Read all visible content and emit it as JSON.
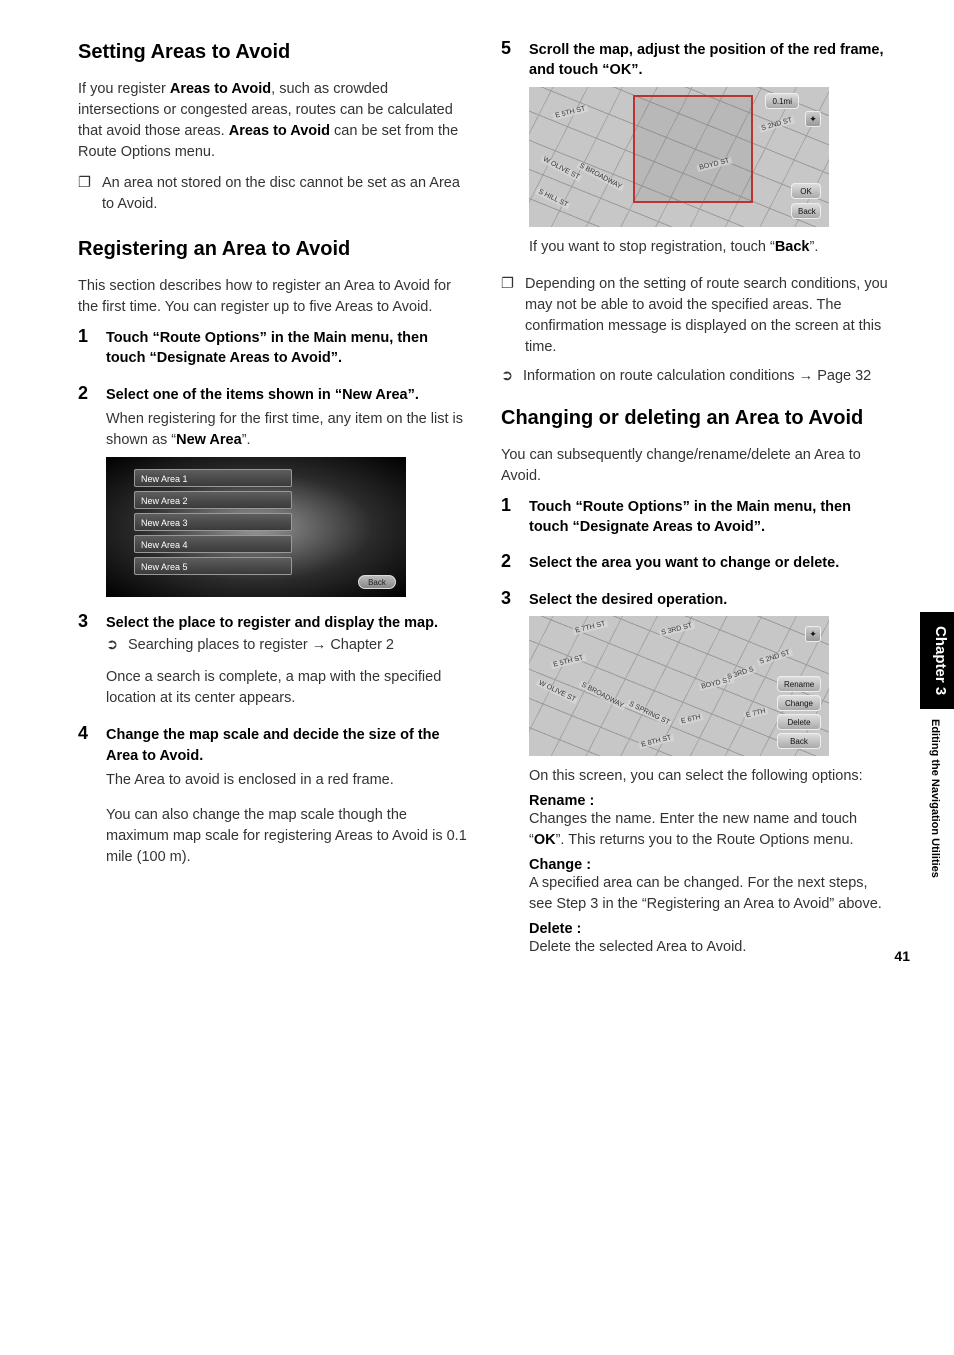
{
  "left": {
    "h1a": "Setting Areas to Avoid",
    "intro1_a": "If you register ",
    "intro1_b": "Areas to Avoid",
    "intro1_c": ", such as crowded intersections or congested areas, routes can be calculated that avoid those areas. ",
    "intro1_d": "Areas to Avoid",
    "intro1_e": " can be set from the Route Options menu.",
    "note1": "An area not stored on the disc cannot be set as an Area to Avoid.",
    "h1b": "Registering an Area to Avoid",
    "intro2": "This section describes how to register an Area to Avoid for the first time. You can register up to five Areas to Avoid.",
    "s1t": "Touch “Route Options” in the Main menu, then touch “Designate Areas to Avoid”.",
    "s2t": "Select one of the items shown in “New Area”.",
    "s2b_a": "When registering for the first time, any item on the list is shown as “",
    "s2b_b": "New Area",
    "s2b_c": "”.",
    "list": [
      "New Area 1",
      "New Area 2",
      "New Area 3",
      "New Area 4",
      "New Area 5"
    ],
    "back": "Back",
    "s3t": "Select the place to register and display the map.",
    "s3x1": "Searching places to register",
    "s3x2": "Chapter 2",
    "s3b": "Once a search is complete, a map with the specified location at its center appears.",
    "s4t": "Change the map scale and decide the size of the Area to Avoid.",
    "s4b1": "The Area to avoid is enclosed in a red frame.",
    "s4b2": "You can also change the map scale though the maximum map scale for registering Areas to Avoid is 0.1 mile (100 m)."
  },
  "right": {
    "s5t": "Scroll the map, adjust the position of the red frame, and touch “OK”.",
    "map1": {
      "scale": "0.1mi",
      "ok": "OK",
      "back": "Back",
      "streets": [
        "E 5TH ST",
        "S 2ND ST",
        "W OLIVE ST",
        "S BROADWAY",
        "S HILL ST",
        "BOYD ST"
      ]
    },
    "s5b_a": "If you want to stop registration, touch “",
    "s5b_b": "Back",
    "s5b_c": "”.",
    "note2": "Depending on the setting of route search conditions, you may not be able to avoid the specified areas. The confirmation message is displayed on the screen at this time.",
    "xref2a": "Information on route calculation conditions",
    "xref2b": "Page 32",
    "h1c": "Changing or deleting an Area to Avoid",
    "intro3": "You can subsequently change/rename/delete an Area to Avoid.",
    "c1t": "Touch “Route Options” in the Main menu, then touch “Designate Areas to Avoid”.",
    "c2t": "Select the area you want to change or delete.",
    "c3t": "Select the desired operation.",
    "map2": {
      "rename": "Rename",
      "change": "Change",
      "delete": "Delete",
      "back": "Back",
      "streets": [
        "E 7TH ST",
        "S 3RD ST",
        "E 5TH ST",
        "S 2ND ST",
        "W OLIVE ST",
        "S BROADWAY",
        "S SPRING ST",
        "E 8TH ST",
        "BOYD ST",
        "S 3RD S",
        "E 6TH",
        "E 7TH"
      ]
    },
    "c3b": "On this screen, you can select the following options:",
    "renameL": "Rename :",
    "renameT_a": "Changes the name. Enter the new name and touch “",
    "renameT_b": "OK",
    "renameT_c": "”. This returns you to the Route Options menu.",
    "changeL": "Change :",
    "changeT": "A specified area can be changed. For the next steps, see Step 3 in the “Registering an Area to Avoid” above.",
    "deleteL": "Delete :",
    "deleteT": "Delete the selected Area to Avoid."
  },
  "side": {
    "chapter": "Chapter 3",
    "subtitle": "Editing the Navigation Utilities"
  },
  "pagenum": "41"
}
